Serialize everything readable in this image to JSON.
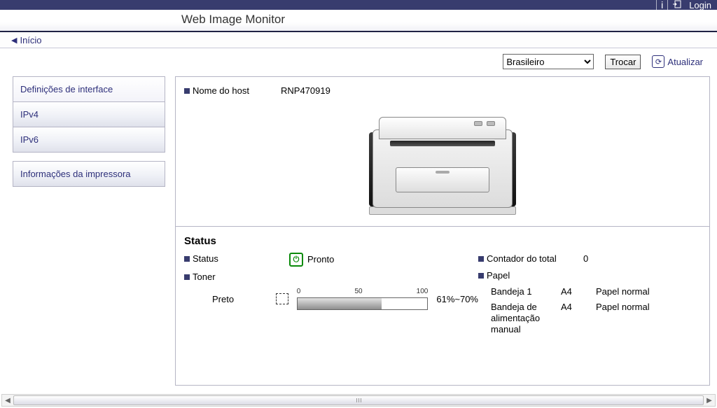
{
  "app_title": "Web Image Monitor",
  "header": {
    "login_label": "Login"
  },
  "breadcrumb": {
    "home": "Início"
  },
  "toolbar": {
    "language_options": [
      "Brasileiro"
    ],
    "selected_language": "Brasileiro",
    "swap_label": "Trocar",
    "refresh_label": "Atualizar"
  },
  "sidebar": {
    "group1": [
      "Definições de interface",
      "IPv4",
      "IPv6"
    ],
    "group2": [
      "Informações da impressora"
    ]
  },
  "host": {
    "label": "Nome do host",
    "value": "RNP470919"
  },
  "status": {
    "section_title": "Status",
    "status_label": "Status",
    "status_value": "Pronto",
    "toner_label": "Toner",
    "counter_label": "Contador do total",
    "counter_value": "0",
    "paper_label": "Papel",
    "toner": {
      "name": "Preto",
      "scale": {
        "min": "0",
        "mid": "50",
        "max": "100"
      },
      "level_text": "61%~70%",
      "level_percent": 65
    },
    "paper_rows": [
      {
        "name": "Bandeja 1",
        "size": "A4",
        "type": "Papel normal"
      },
      {
        "name": "Bandeja de alimentação manual",
        "size": "A4",
        "type": "Papel normal"
      }
    ]
  }
}
